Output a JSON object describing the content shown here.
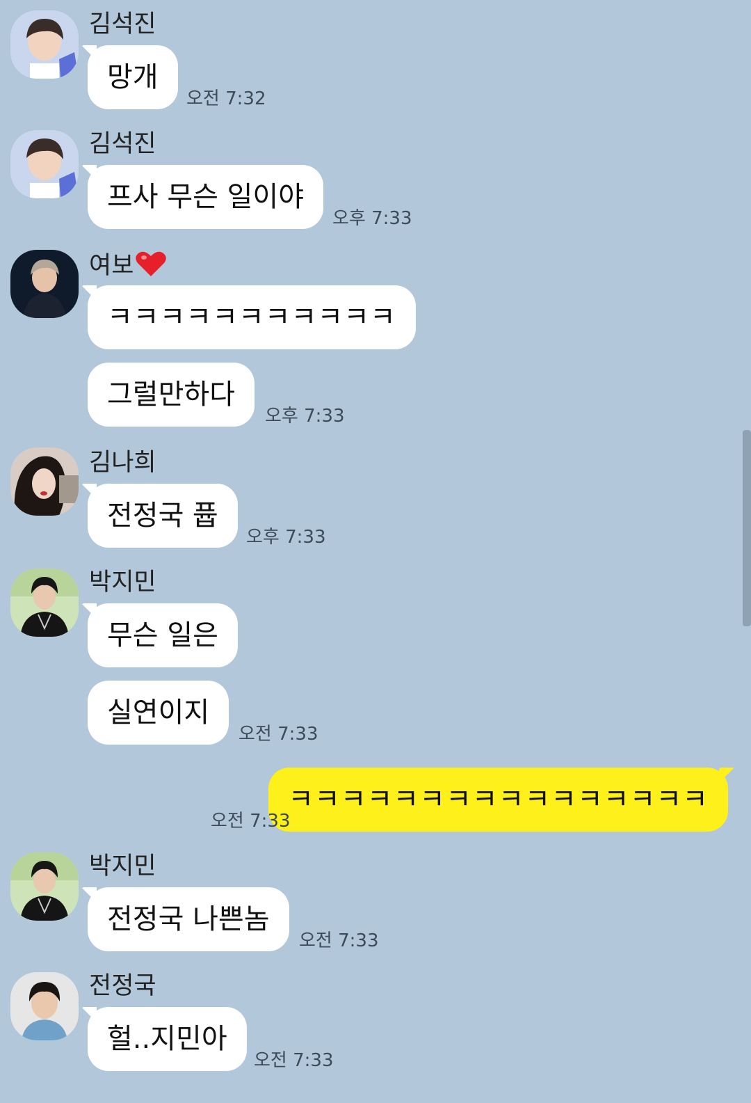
{
  "messages": [
    {
      "sender": "김석진",
      "avatar": "jin-avatar-icon",
      "bubbles": [
        "망개"
      ],
      "time": "오전 7:32"
    },
    {
      "sender": "김석진",
      "avatar": "jin-avatar-icon",
      "bubbles": [
        "프사 무슨 일이야"
      ],
      "time": "오후 7:33"
    },
    {
      "sender": "여보",
      "avatar": "yeobo-avatar-icon",
      "bubbles": [
        "ㅋㅋㅋㅋㅋㅋㅋㅋㅋㅋㅋ",
        "그럴만하다"
      ],
      "time": "오후 7:33"
    },
    {
      "sender": "김나희",
      "avatar": "nahee-avatar-icon",
      "bubbles": [
        "전정국 퓹"
      ],
      "time": "오후 7:33"
    },
    {
      "sender": "박지민",
      "avatar": "jimin-avatar-icon",
      "bubbles": [
        "무슨 일은",
        "실연이지"
      ],
      "time": "오전 7:33"
    },
    {
      "sender": "",
      "mine": true,
      "bubbles": [
        "ㅋㅋㅋㅋㅋㅋㅋㅋㅋㅋㅋㅋㅋㅋㅋㅋ"
      ],
      "time": "오전 7:33"
    },
    {
      "sender": "박지민",
      "avatar": "jimin-avatar-icon",
      "bubbles": [
        "전정국 나쁜놈"
      ],
      "time": "오전 7:33"
    },
    {
      "sender": "전정국",
      "avatar": "jungkook-avatar-icon",
      "bubbles": [
        "헐..지민아"
      ],
      "time": "오전 7:33"
    }
  ],
  "colors": {
    "background": "#b2c7da",
    "bubble_other": "#ffffff",
    "bubble_mine": "#fef01b"
  }
}
